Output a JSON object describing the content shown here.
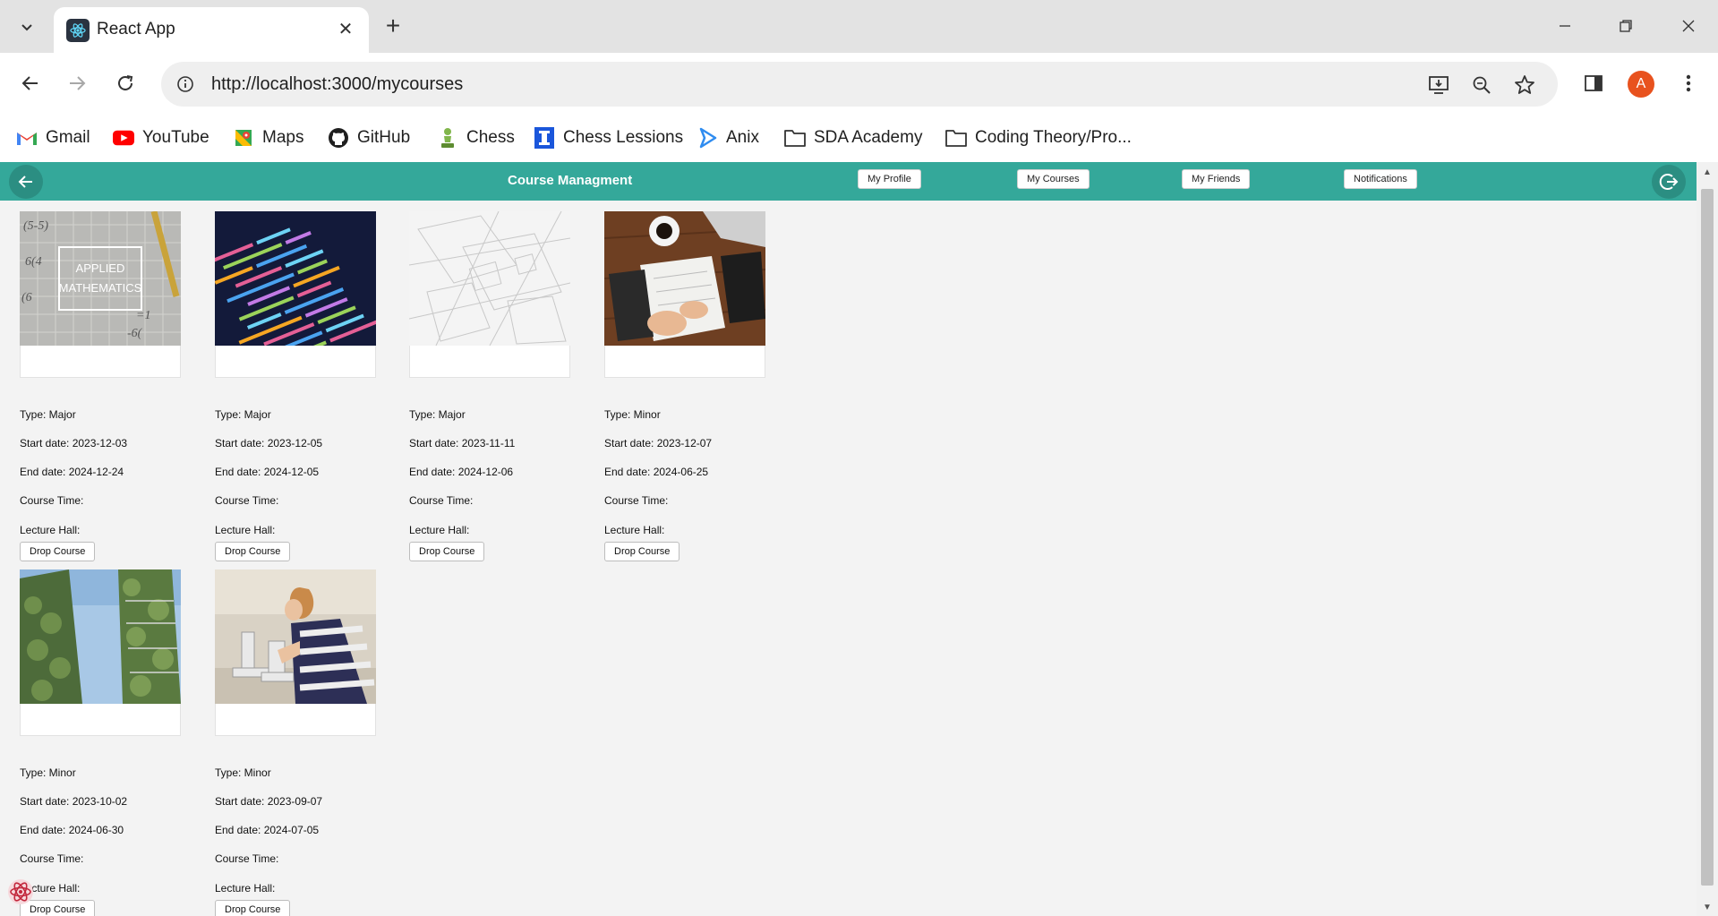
{
  "browser": {
    "tab_title": "React App",
    "url": "http://localhost:3000/mycourses",
    "profile_initial": "A",
    "bookmarks": [
      {
        "label": "Gmail",
        "icon": "gmail-icon"
      },
      {
        "label": "YouTube",
        "icon": "youtube-icon"
      },
      {
        "label": "Maps",
        "icon": "maps-icon"
      },
      {
        "label": "GitHub",
        "icon": "github-icon"
      },
      {
        "label": "Chess",
        "icon": "chess-pawn-icon"
      },
      {
        "label": "Chess Lessions",
        "icon": "chess-lessons-icon"
      },
      {
        "label": "Anix",
        "icon": "anix-play-icon"
      },
      {
        "label": "SDA Academy",
        "icon": "folder-icon"
      },
      {
        "label": "Coding Theory/Pro...",
        "icon": "folder-icon"
      }
    ]
  },
  "app": {
    "title": "Course Managment",
    "accent_color": "#34a89a",
    "nav": {
      "my_profile": "My Profile",
      "my_courses": "My Courses",
      "my_friends": "My Friends",
      "notifications": "Notifications"
    }
  },
  "courses": [
    {
      "image": "applied-mathematics-photo",
      "image_text": [
        "APPLIED",
        "MATHEMATICS"
      ],
      "type": "Type: Major",
      "start": "Start date: 2023-12-03",
      "end": "End date: 2024-12-24",
      "time": "Course Time:",
      "hall": "Lecture Hall:",
      "action": "Drop Course"
    },
    {
      "image": "code-screen-photo",
      "type": "Type: Major",
      "start": "Start date: 2023-12-05",
      "end": "End date: 2024-12-05",
      "time": "Course Time:",
      "hall": "Lecture Hall:",
      "action": "Drop Course"
    },
    {
      "image": "architecture-blueprint-photo",
      "type": "Type: Major",
      "start": "Start date: 2023-11-11",
      "end": "End date: 2024-12-06",
      "time": "Course Time:",
      "hall": "Lecture Hall:",
      "action": "Drop Course"
    },
    {
      "image": "desk-writing-photo",
      "type": "Type: Minor",
      "start": "Start date: 2023-12-07",
      "end": "End date: 2024-06-25",
      "time": "Course Time:",
      "hall": "Lecture Hall:",
      "action": "Drop Course"
    },
    {
      "image": "green-towers-photo",
      "type": "Type: Minor",
      "start": "Start date: 2023-10-02",
      "end": "End date: 2024-06-30",
      "time": "Course Time:",
      "hall": "Lecture Hall:",
      "action": "Drop Course"
    },
    {
      "image": "microscope-student-photo",
      "type": "Type: Minor",
      "start": "Start date: 2023-09-07",
      "end": "End date: 2024-07-05",
      "time": "Course Time:",
      "hall": "Lecture Hall:",
      "action": "Drop Course"
    }
  ]
}
